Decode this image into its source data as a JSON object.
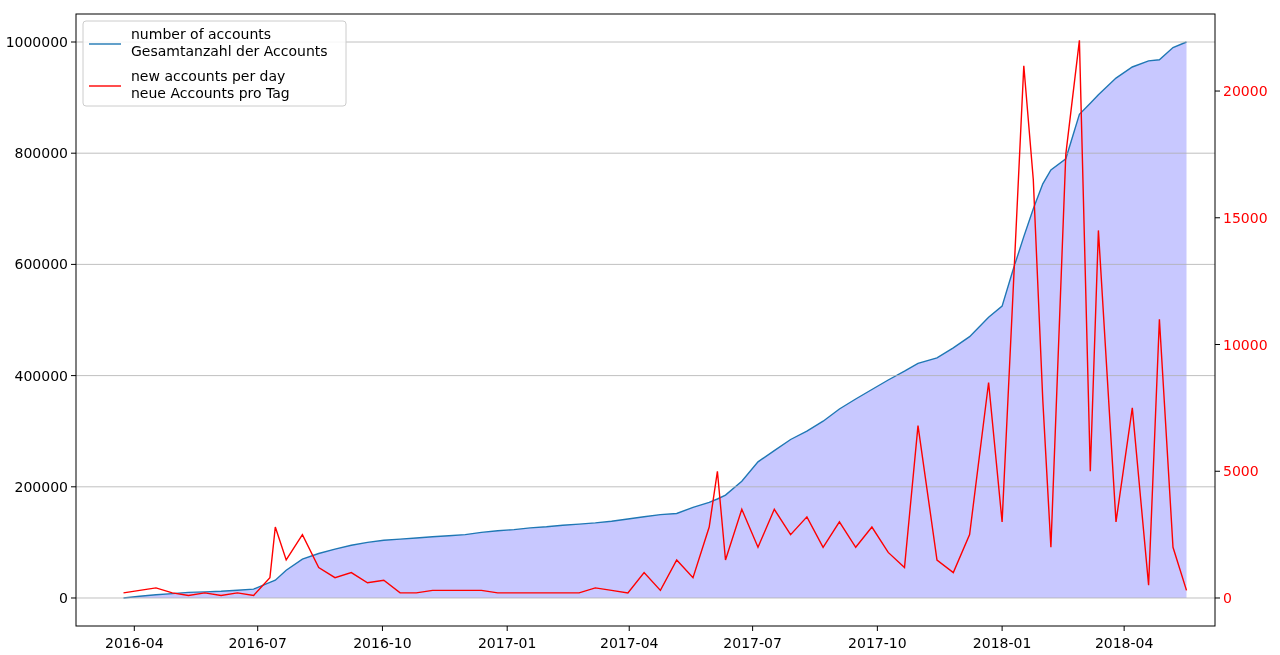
{
  "chart": {
    "chart_data": {
      "type": "line",
      "grid": "y",
      "legend": "upper left",
      "xlim": [
        "2016-02-18",
        "2018-06-07"
      ],
      "ylim": [
        -50360,
        1050360
      ],
      "y2lim": [
        -1105,
        23039
      ],
      "xticks": [
        {
          "value": "2016-04-01",
          "label": "2016-04"
        },
        {
          "value": "2016-07-01",
          "label": "2016-07"
        },
        {
          "value": "2016-10-01",
          "label": "2016-10"
        },
        {
          "value": "2017-01-01",
          "label": "2017-01"
        },
        {
          "value": "2017-04-01",
          "label": "2017-04"
        },
        {
          "value": "2017-07-01",
          "label": "2017-07"
        },
        {
          "value": "2017-10-01",
          "label": "2017-10"
        },
        {
          "value": "2018-01-01",
          "label": "2018-01"
        },
        {
          "value": "2018-04-01",
          "label": "2018-04"
        }
      ],
      "yticks": [
        {
          "value": 0,
          "label": "0"
        },
        {
          "value": 200000,
          "label": "200000"
        },
        {
          "value": 400000,
          "label": "400000"
        },
        {
          "value": 600000,
          "label": "600000"
        },
        {
          "value": 800000,
          "label": "800000"
        },
        {
          "value": 1000000,
          "label": "1000000"
        }
      ],
      "y2ticks": [
        {
          "value": 0,
          "label": "0"
        },
        {
          "value": 5000,
          "label": "5000"
        },
        {
          "value": 10000,
          "label": "10000"
        },
        {
          "value": 15000,
          "label": "15000"
        },
        {
          "value": 20000,
          "label": "20000"
        }
      ],
      "x": [
        "2016-03-24",
        "2016-04-05",
        "2016-04-17",
        "2016-04-29",
        "2016-05-11",
        "2016-05-23",
        "2016-06-04",
        "2016-06-16",
        "2016-06-28",
        "2016-07-10",
        "2016-07-14",
        "2016-07-22",
        "2016-08-03",
        "2016-08-15",
        "2016-08-27",
        "2016-09-08",
        "2016-09-20",
        "2016-10-02",
        "2016-10-14",
        "2016-10-26",
        "2016-11-07",
        "2016-11-19",
        "2016-12-01",
        "2016-12-13",
        "2016-12-25",
        "2017-01-06",
        "2017-01-18",
        "2017-01-30",
        "2017-02-11",
        "2017-02-23",
        "2017-03-07",
        "2017-03-19",
        "2017-03-31",
        "2017-04-12",
        "2017-04-24",
        "2017-05-06",
        "2017-05-18",
        "2017-05-30",
        "2017-06-05",
        "2017-06-11",
        "2017-06-23",
        "2017-07-05",
        "2017-07-17",
        "2017-07-29",
        "2017-08-10",
        "2017-08-22",
        "2017-09-03",
        "2017-09-15",
        "2017-09-27",
        "2017-10-09",
        "2017-10-21",
        "2017-10-31",
        "2017-11-14",
        "2017-11-26",
        "2017-12-08",
        "2017-12-22",
        "2018-01-01",
        "2018-01-09",
        "2018-01-17",
        "2018-01-24",
        "2018-01-31",
        "2018-02-06",
        "2018-02-17",
        "2018-02-27",
        "2018-03-07",
        "2018-03-13",
        "2018-03-26",
        "2018-04-07",
        "2018-04-19",
        "2018-04-27",
        "2018-05-07",
        "2018-05-17"
      ],
      "series": [
        {
          "name": "number of accounts\nGesamtanzahl der Accounts",
          "type": "area",
          "color": "#1f77b4",
          "values": [
            0,
            3000,
            6000,
            8000,
            10000,
            11000,
            12000,
            14000,
            16000,
            28000,
            32000,
            50000,
            70000,
            80000,
            88000,
            95000,
            100000,
            104000,
            106000,
            108000,
            110000,
            112000,
            114000,
            118000,
            121000,
            123000,
            126000,
            128000,
            131000,
            133000,
            135000,
            138000,
            142000,
            146000,
            150000,
            152000,
            163000,
            172000,
            178000,
            185000,
            210000,
            245000,
            265000,
            285000,
            300000,
            318000,
            340000,
            358000,
            375000,
            392000,
            408000,
            422000,
            432000,
            450000,
            470000,
            505000,
            525000,
            590000,
            650000,
            700000,
            745000,
            770000,
            790000,
            870000,
            890000,
            905000,
            935000,
            955000,
            966000,
            968000,
            990000,
            1000000
          ]
        },
        {
          "name": "new accounts per day\nneue Accounts pro Tag",
          "color": "#ff0000",
          "axis": "y2",
          "values": [
            200,
            300,
            400,
            200,
            100,
            200,
            100,
            200,
            100,
            800,
            2800,
            1500,
            2500,
            1200,
            800,
            1000,
            600,
            700,
            200,
            200,
            300,
            300,
            300,
            300,
            200,
            200,
            200,
            200,
            200,
            200,
            400,
            300,
            200,
            1000,
            300,
            1500,
            800,
            2800,
            5000,
            1500,
            3500,
            2000,
            3500,
            2500,
            3200,
            2000,
            3000,
            2000,
            2800,
            1800,
            1200,
            6800,
            1500,
            1000,
            2500,
            8500,
            3000,
            12000,
            21000,
            16500,
            7800,
            2000,
            17500,
            22000,
            5000,
            14500,
            3000,
            7500,
            500,
            11000,
            2000,
            300
          ]
        }
      ]
    }
  }
}
